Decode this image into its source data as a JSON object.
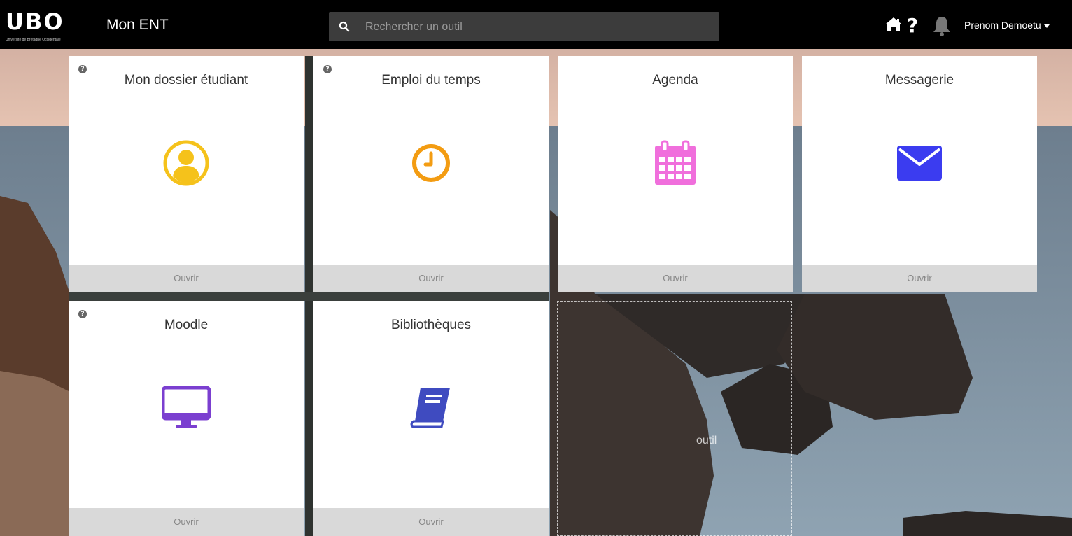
{
  "header": {
    "logo_text": "UBO",
    "logo_subtitle": "Université de Bretagne Occidentale",
    "app_title": "Mon ENT",
    "search_placeholder": "Rechercher un outil",
    "help_label": "?",
    "user_name": "Prenom Demoetu"
  },
  "tiles": [
    {
      "title": "Mon dossier étudiant",
      "open_label": "Ouvrir",
      "icon": "user-circle-icon",
      "color": "#f5c21b",
      "has_help": true
    },
    {
      "title": "Emploi du temps",
      "open_label": "Ouvrir",
      "icon": "clock-icon",
      "color": "#f39c12",
      "has_help": true
    },
    {
      "title": "Agenda",
      "open_label": "Ouvrir",
      "icon": "calendar-icon",
      "color": "#f06fdc",
      "has_help": false
    },
    {
      "title": "Messagerie",
      "open_label": "Ouvrir",
      "icon": "envelope-icon",
      "color": "#3b3cf0",
      "has_help": false
    },
    {
      "title": "Moodle",
      "open_label": "Ouvrir",
      "icon": "desktop-icon",
      "color": "#7b3fd0",
      "has_help": true
    },
    {
      "title": "Bibliothèques",
      "open_label": "Ouvrir",
      "icon": "book-icon",
      "color": "#3f4bc0",
      "has_help": false
    }
  ],
  "empty_slot_label": "outil",
  "help_glyph": "?",
  "colors": {
    "topbar": "#000000",
    "tile_footer": "#d9d9d9"
  }
}
